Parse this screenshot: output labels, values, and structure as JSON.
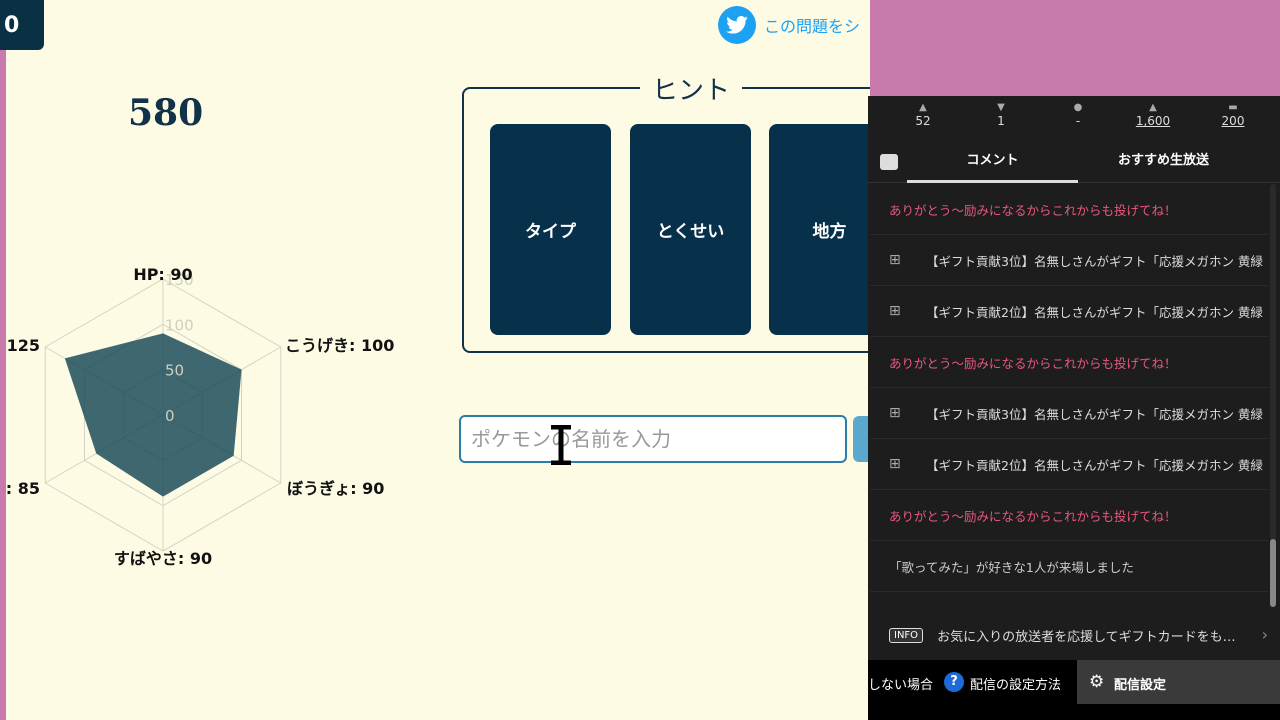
{
  "game": {
    "score_badge": "0",
    "total_stats": "580",
    "tweet_label": "この問題をシ",
    "hint": {
      "title": "ヒント",
      "cards": [
        "タイプ",
        "とくせい",
        "地方"
      ]
    },
    "name_input": {
      "placeholder": "ポケモンの名前を入力"
    },
    "radar": {
      "scale_labels": [
        "150",
        "100",
        "50",
        "0"
      ],
      "stats": [
        {
          "label": "HP: 90",
          "value": 90
        },
        {
          "label": "こうげき: 100",
          "value": 100
        },
        {
          "label": "ぼうぎょ: 90",
          "value": 90
        },
        {
          "label": "すばやさ: 90",
          "value": 90
        },
        {
          "label": ": 85",
          "value": 85
        },
        {
          "label": "125",
          "value": 125
        }
      ],
      "max": 150,
      "fill_color": "#0f4252"
    }
  },
  "panel": {
    "stats": [
      {
        "value": "52",
        "icon": "viewer-icon"
      },
      {
        "value": "1",
        "icon": "comment-count-icon"
      },
      {
        "value": "-",
        "icon": "ad-icon"
      },
      {
        "value": "1,600",
        "icon": "point-icon"
      },
      {
        "value": "200",
        "icon": "gift-icon"
      }
    ],
    "tabs": [
      "コメント",
      "おすすめ生放送"
    ],
    "comments": [
      {
        "type": "pink",
        "text": "ありがとう～励みになるからこれからも投げてね！"
      },
      {
        "type": "gift",
        "text": "【ギフト貢献3位】名無しさんがギフト「応援メガホン 黄緑"
      },
      {
        "type": "gift",
        "text": "【ギフト貢献2位】名無しさんがギフト「応援メガホン 黄緑"
      },
      {
        "type": "pink",
        "text": "ありがとう～励みになるからこれからも投げてね！"
      },
      {
        "type": "gift",
        "text": "【ギフト貢献3位】名無しさんがギフト「応援メガホン 黄緑"
      },
      {
        "type": "gift",
        "text": "【ギフト貢献2位】名無しさんがギフト「応援メガホン 黄緑"
      },
      {
        "type": "pink",
        "text": "ありがとう～励みになるからこれからも投げてね！"
      },
      {
        "type": "sys",
        "text": "「歌ってみた」が好きな1人が来場しました"
      }
    ],
    "info": {
      "badge": "INFO",
      "text": "お気に入りの放送者を応援してギフトカードをも…"
    },
    "bottom": {
      "noshow": "しない場合",
      "help_label": "配信の設定方法",
      "settings_label": "配信設定"
    }
  }
}
